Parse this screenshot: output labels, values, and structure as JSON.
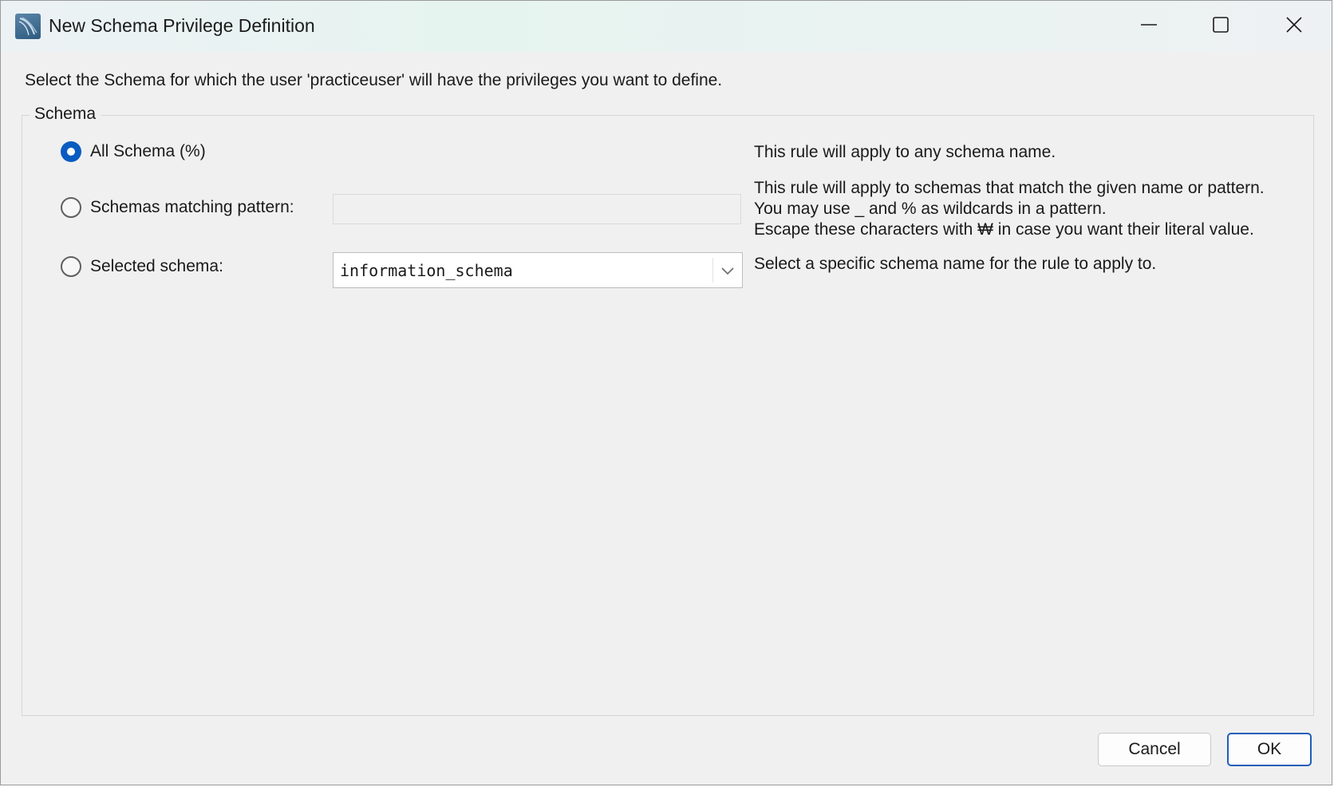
{
  "window": {
    "title": "New Schema Privilege Definition",
    "icon": "mysql-workbench-dolphin-icon",
    "controls": [
      "minimize-icon",
      "maximize-icon",
      "close-icon"
    ]
  },
  "intro_text": "Select the Schema for which the user 'practiceuser' will have the privileges you want to define.",
  "schema_group": {
    "legend": "Schema",
    "options": [
      {
        "label": "All Schema (%)",
        "checked": true,
        "description": [
          "This rule will apply to any schema name."
        ]
      },
      {
        "label": "Schemas matching pattern:",
        "checked": false,
        "input_value": "",
        "description": [
          "This rule will apply to schemas that match the given name or pattern.",
          "You may use _ and % as wildcards in a pattern.",
          "Escape these characters with ₩ in case you want their literal value."
        ]
      },
      {
        "label": "Selected schema:",
        "checked": false,
        "selected_value": "information_schema",
        "description": [
          "Select a specific schema name for the rule to apply to."
        ]
      }
    ]
  },
  "buttons": {
    "cancel": "Cancel",
    "ok": "OK"
  },
  "colors": {
    "accent": "#0a5cc0",
    "dialog_bg": "#f0f0f0",
    "ok_border": "#1f5fb8"
  }
}
